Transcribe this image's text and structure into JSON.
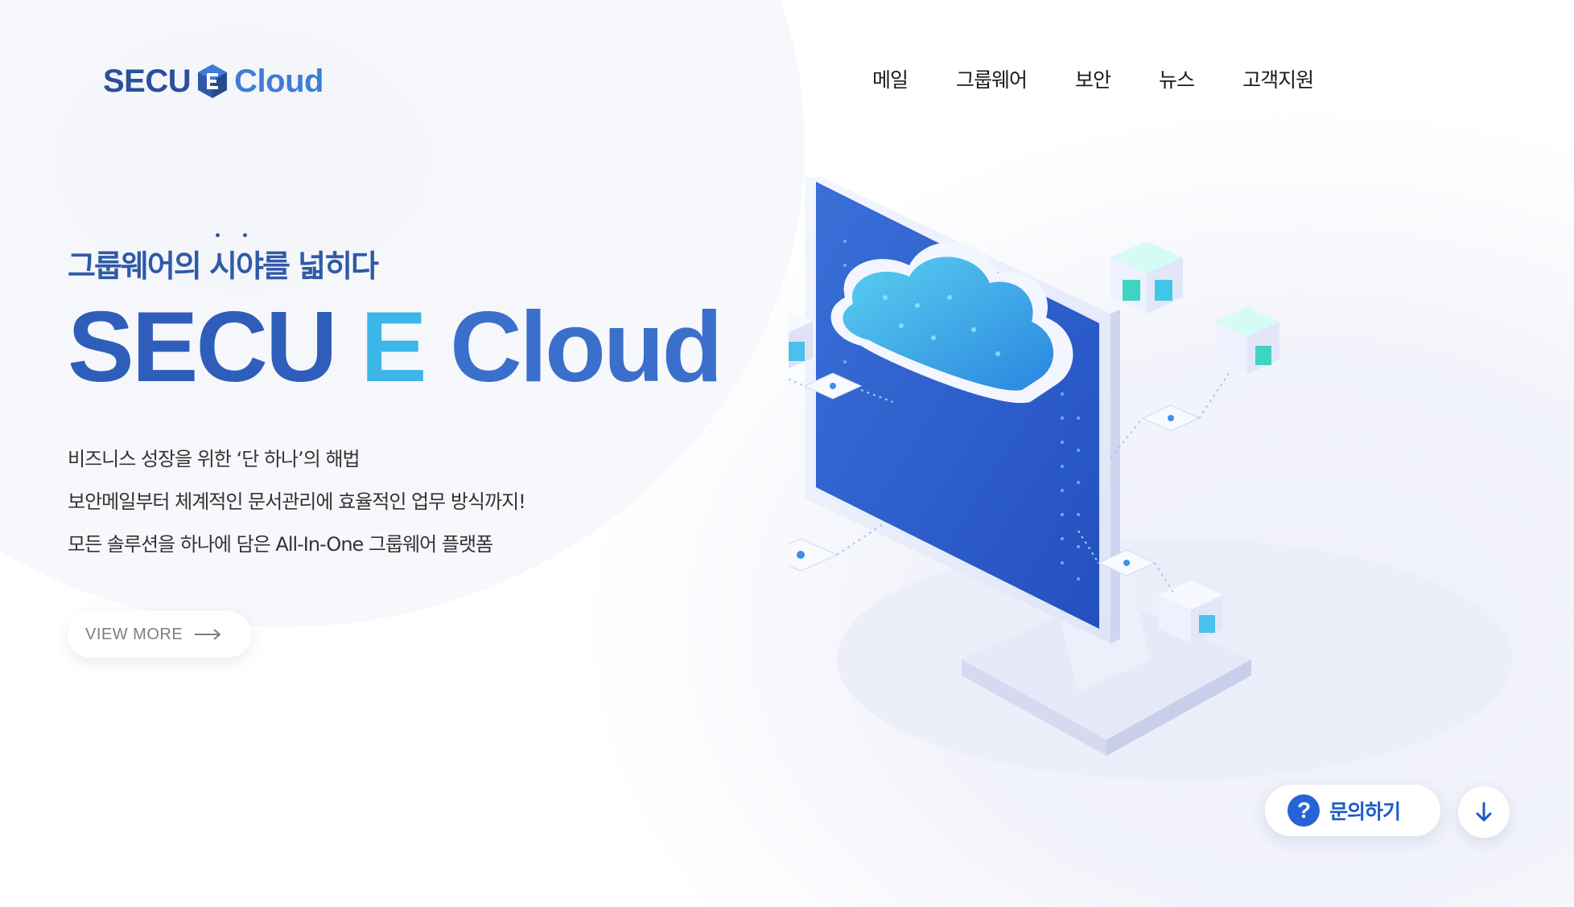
{
  "header": {
    "logo": {
      "text_left": "SECU",
      "text_right": "Cloud",
      "mark_icon": "secu-e-cube-icon"
    },
    "nav": [
      {
        "label": "메일"
      },
      {
        "label": "그룹웨어"
      },
      {
        "label": "보안"
      },
      {
        "label": "뉴스"
      },
      {
        "label": "고객지원"
      }
    ]
  },
  "hero": {
    "kicker": "그룹웨어의 시야를 넓히다",
    "title": {
      "part1": "SECU",
      "part2": "E",
      "part3": "Cloud"
    },
    "description": [
      "비즈니스 성장을 위한 ‘단 하나’의 해법",
      "보안메일부터 체계적인 문서관리에 효율적인 업무 방식까지!",
      "모든 솔루션을 하나에 담은 All-In-One 그룹웨어 플랫폼"
    ],
    "view_more": {
      "label": "VIEW MORE",
      "icon": "arrow-right-icon"
    }
  },
  "floating": {
    "inquiry": {
      "label": "문의하기",
      "icon": "question-bubble-icon"
    },
    "scroll_down": {
      "icon": "arrow-down-icon"
    }
  },
  "colors": {
    "brand_dark": "#2a4f9c",
    "brand_blue": "#3a6fcb",
    "accent_cyan": "#3cb6e6",
    "inquiry_blue": "#2563d6"
  }
}
